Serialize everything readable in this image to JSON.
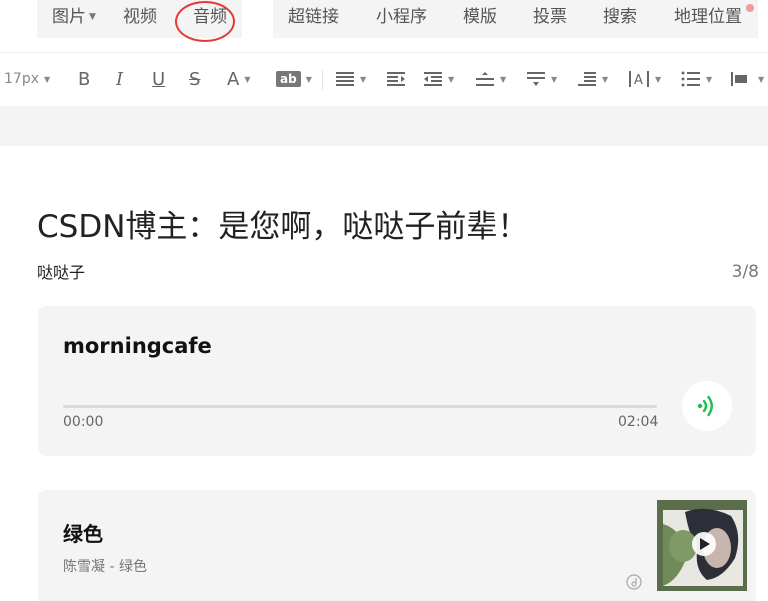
{
  "menu": {
    "items": [
      {
        "label": "图片",
        "caret": true
      },
      {
        "label": "视频",
        "caret": false
      },
      {
        "label": "音频",
        "caret": false
      },
      {
        "label": "超链接",
        "caret": false
      },
      {
        "label": "小程序",
        "caret": false
      },
      {
        "label": "模版",
        "caret": false
      },
      {
        "label": "投票",
        "caret": false
      },
      {
        "label": "搜索",
        "caret": false
      },
      {
        "label": "地理位置",
        "caret": false
      }
    ],
    "highlighted": "音频",
    "highlight_color": "#e53935"
  },
  "toolbar": {
    "font_size": "17px",
    "bold_label": "B",
    "italic_label": "I",
    "underline_label": "U",
    "strike_label": "S",
    "font_color_label": "A",
    "bg_color_label": "ab",
    "icons": [
      "align-icon",
      "indent-icon",
      "outdent-icon",
      "line-height-icon",
      "para-spacing-icon",
      "list-indent-icon",
      "letter-spacing-icon",
      "bullet-list-icon",
      "block-align-icon"
    ]
  },
  "article": {
    "title": "CSDN博主：是您啊，哒哒子前辈！",
    "author": "哒哒子",
    "page_count": "3/8"
  },
  "audio": {
    "name": "morningcafe",
    "current_time": "00:00",
    "duration": "02:04",
    "progress": 0,
    "accent_color": "#1ebe4f"
  },
  "music": {
    "title": "绿色",
    "artist_line": "陈雪凝 - 绿色",
    "cover_icon": "play-icon"
  }
}
